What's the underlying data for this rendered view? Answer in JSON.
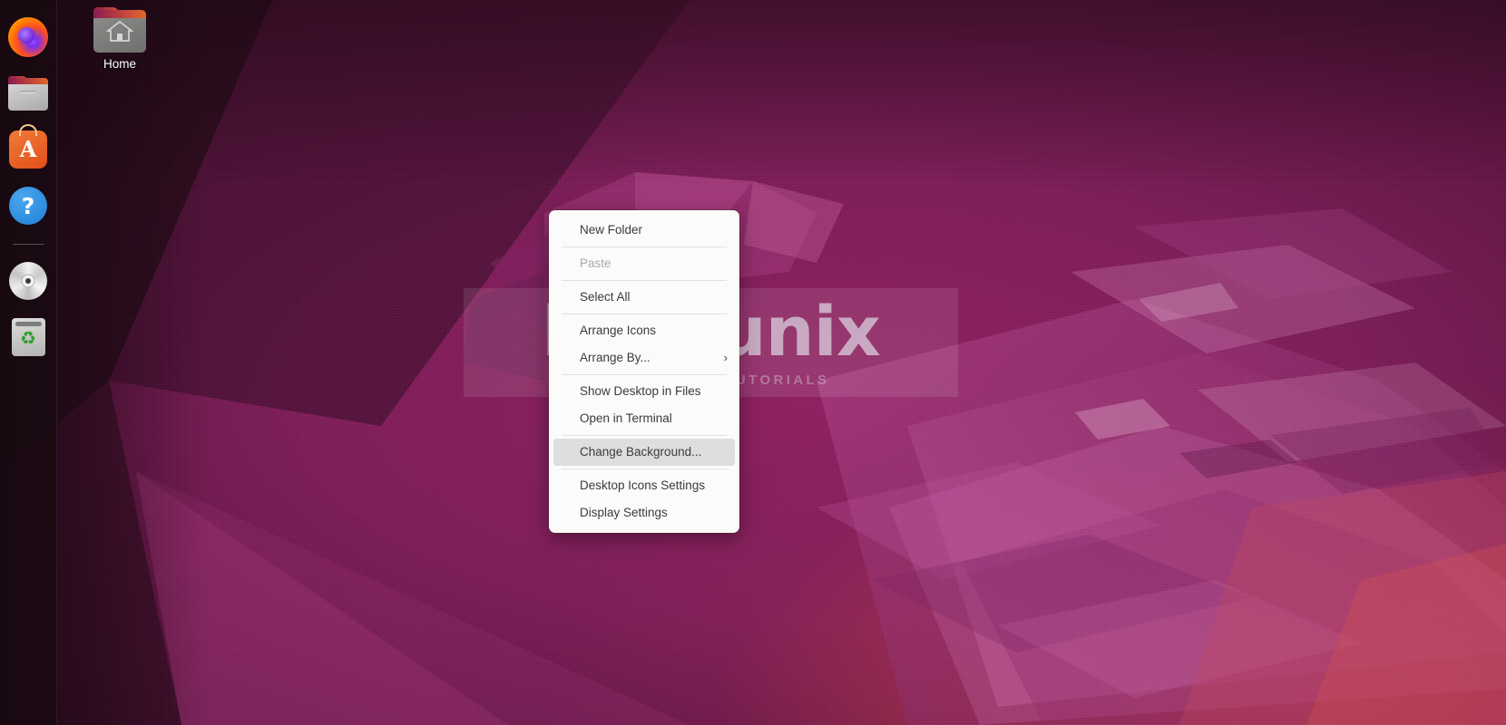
{
  "desktop": {
    "wallpaper_name": "ubuntu-focal-wallpaper",
    "colors": {
      "accent_purple": "#8b2162",
      "accent_magenta": "#a8325f",
      "accent_coral": "#d64842",
      "dark_edge": "#1d0d15",
      "dock_bg": "#190a12",
      "menu_bg": "#fbfbfa",
      "menu_text": "#3b3b40",
      "menu_text_disabled": "#a8a8ab",
      "menu_selected_bg": "#dedede",
      "ubuntu_orange": "#e24f18"
    }
  },
  "watermark": {
    "main": "kifarunix",
    "sub": "LINUX TIPS & TUTORIALS"
  },
  "dock": {
    "items": [
      {
        "name": "firefox",
        "label": "Firefox Web Browser",
        "icon": "firefox-icon"
      },
      {
        "name": "files",
        "label": "Files",
        "icon": "folder-icon"
      },
      {
        "name": "software",
        "label": "Ubuntu Software",
        "icon": "software-bag-icon",
        "glyph": "A"
      },
      {
        "name": "help",
        "label": "Help",
        "icon": "question-mark-icon",
        "glyph": "?"
      },
      {
        "name": "disc",
        "label": "CD/DVD Drive",
        "icon": "optical-disc-icon"
      },
      {
        "name": "trash",
        "label": "Trash",
        "icon": "trash-bin-icon",
        "glyph": "♻"
      }
    ]
  },
  "desktop_icons": [
    {
      "name": "home",
      "label": "Home",
      "icon": "home-folder-icon"
    }
  ],
  "context_menu": {
    "items": [
      {
        "label": "New Folder",
        "state": "normal",
        "separator_after": true,
        "submenu": false
      },
      {
        "label": "Paste",
        "state": "disabled",
        "separator_after": true,
        "submenu": false
      },
      {
        "label": "Select All",
        "state": "normal",
        "separator_after": true,
        "submenu": false
      },
      {
        "label": "Arrange Icons",
        "state": "normal",
        "separator_after": false,
        "submenu": false
      },
      {
        "label": "Arrange By...",
        "state": "normal",
        "separator_after": true,
        "submenu": true,
        "arrow": "›"
      },
      {
        "label": "Show Desktop in Files",
        "state": "normal",
        "separator_after": false,
        "submenu": false
      },
      {
        "label": "Open in Terminal",
        "state": "normal",
        "separator_after": true,
        "submenu": false
      },
      {
        "label": "Change Background...",
        "state": "selected",
        "separator_after": true,
        "submenu": false
      },
      {
        "label": "Desktop Icons Settings",
        "state": "normal",
        "separator_after": false,
        "submenu": false
      },
      {
        "label": "Display Settings",
        "state": "normal",
        "separator_after": false,
        "submenu": false
      }
    ]
  }
}
